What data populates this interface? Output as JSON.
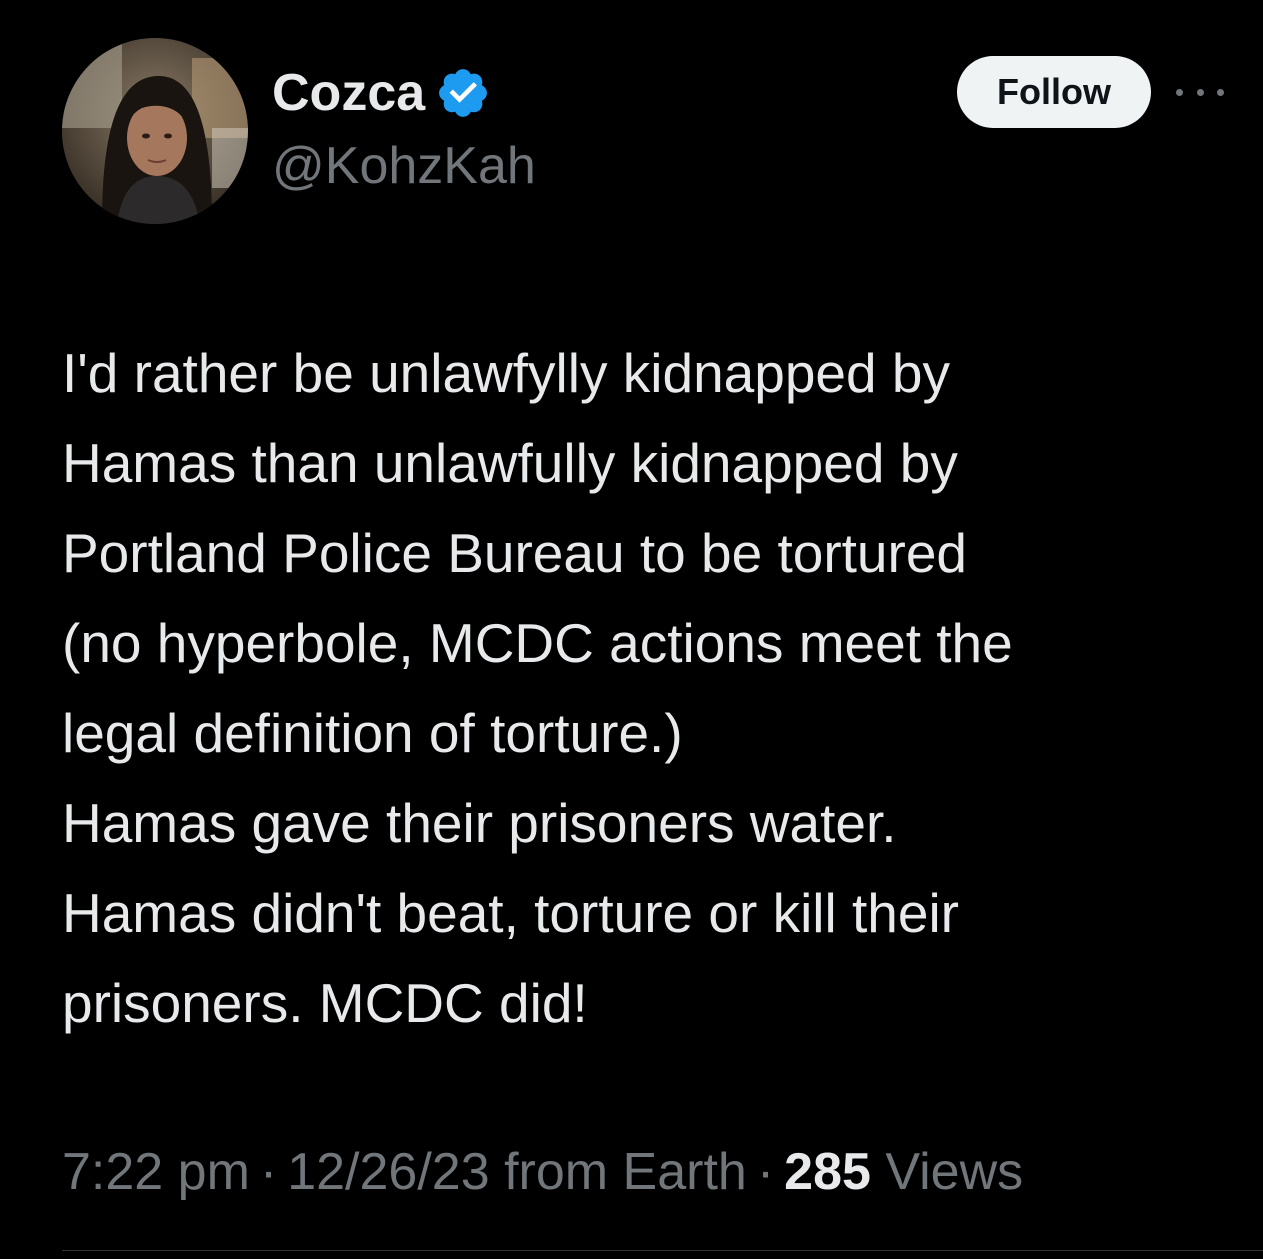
{
  "author": {
    "display_name": "Cozca",
    "handle": "@KohzKah",
    "verified": true,
    "avatar_icon": "profile-photo"
  },
  "actions": {
    "follow_label": "Follow",
    "more_icon": "ellipsis-icon"
  },
  "tweet": {
    "lines": [
      "I'd rather be unlawfylly kidnapped by",
      "Hamas than unlawfully kidnapped by",
      "Portland Police Bureau to be tortured",
      "(no hyperbole, MCDC actions meet the",
      "legal definition of torture.)",
      "Hamas gave their prisoners water.",
      "Hamas didn't beat, torture or kill their",
      "prisoners. MCDC did!"
    ]
  },
  "meta": {
    "time": "7:22 pm",
    "date_source": "12/26/23 from Earth",
    "separator": "·",
    "views_count": "285",
    "views_label": "Views"
  },
  "colors": {
    "background": "#000000",
    "primary_text": "#e7e9ea",
    "secondary_text": "#71767b",
    "verified_blue": "#1d9bf0",
    "follow_bg": "#eff3f4"
  }
}
